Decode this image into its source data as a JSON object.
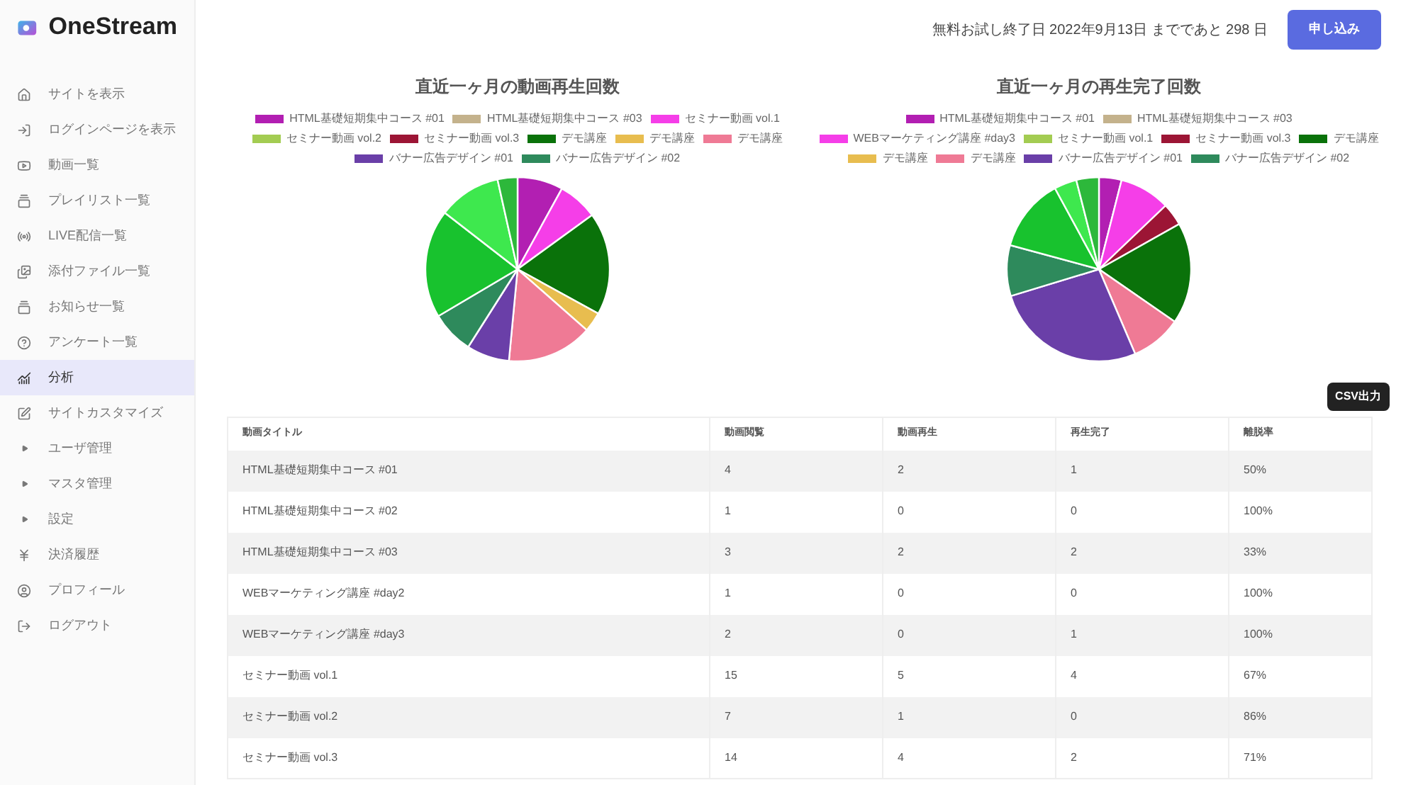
{
  "brand": {
    "name": "OneStream"
  },
  "sidebar": {
    "items": [
      {
        "label": "サイトを表示",
        "selected": false
      },
      {
        "label": "ログインページを表示",
        "selected": false
      },
      {
        "label": "動画一覧",
        "selected": false
      },
      {
        "label": "プレイリスト一覧",
        "selected": false
      },
      {
        "label": "LIVE配信一覧",
        "selected": false
      },
      {
        "label": "添付ファイル一覧",
        "selected": false
      },
      {
        "label": "お知らせ一覧",
        "selected": false
      },
      {
        "label": "アンケート一覧",
        "selected": false
      },
      {
        "label": "分析",
        "selected": true
      },
      {
        "label": "サイトカスタマイズ",
        "selected": false
      },
      {
        "label": "ユーザ管理",
        "selected": false
      },
      {
        "label": "マスタ管理",
        "selected": false
      },
      {
        "label": "設定",
        "selected": false
      },
      {
        "label": "決済履歴",
        "selected": false
      },
      {
        "label": "プロフィール",
        "selected": false
      },
      {
        "label": "ログアウト",
        "selected": false
      }
    ]
  },
  "header": {
    "trial_notice": "無料お試し終了日 2022年9月13日 までであと 298 日",
    "apply_button": "申し込み"
  },
  "charts": [
    {
      "title": "直近一ヶ月の動画再生回数",
      "legend": [
        {
          "label": "HTML基礎短期集中コース #01",
          "color": "#b21fb2"
        },
        {
          "label": "HTML基礎短期集中コース #03",
          "color": "#c4b28c"
        },
        {
          "label": "セミナー動画 vol.1",
          "color": "#f53ee8"
        },
        {
          "label": "セミナー動画 vol.2",
          "color": "#a3cc52"
        },
        {
          "label": "セミナー動画 vol.3",
          "color": "#9c1535"
        },
        {
          "label": "デモ講座",
          "color": "#0a720a"
        },
        {
          "label": "デモ講座",
          "color": "#e8bd4f"
        },
        {
          "label": "デモ講座",
          "color": "#ef7a95"
        },
        {
          "label": "バナー広告デザイン #01",
          "color": "#6a3fa8"
        },
        {
          "label": "バナー広告デザイン #02",
          "color": "#2e8a5c"
        }
      ]
    },
    {
      "title": "直近一ヶ月の再生完了回数",
      "legend": [
        {
          "label": "HTML基礎短期集中コース #01",
          "color": "#b21fb2"
        },
        {
          "label": "HTML基礎短期集中コース #03",
          "color": "#c4b28c"
        },
        {
          "label": "WEBマーケティング講座 #day3",
          "color": "#f53ee8"
        },
        {
          "label": "セミナー動画 vol.1",
          "color": "#a3cc52"
        },
        {
          "label": "セミナー動画 vol.3",
          "color": "#9c1535"
        },
        {
          "label": "デモ講座",
          "color": "#0a720a"
        },
        {
          "label": "デモ講座",
          "color": "#e8bd4f"
        },
        {
          "label": "デモ講座",
          "color": "#ef7a95"
        },
        {
          "label": "バナー広告デザイン #01",
          "color": "#6a3fa8"
        },
        {
          "label": "バナー広告デザイン #02",
          "color": "#2e8a5c"
        }
      ]
    }
  ],
  "csv_button": "CSV出力",
  "table": {
    "columns": [
      "動画タイトル",
      "動画閲覧",
      "動画再生",
      "再生完了",
      "離脱率"
    ],
    "rows": [
      [
        "HTML基礎短期集中コース #01",
        "4",
        "2",
        "1",
        "50%"
      ],
      [
        "HTML基礎短期集中コース #02",
        "1",
        "0",
        "0",
        "100%"
      ],
      [
        "HTML基礎短期集中コース #03",
        "3",
        "2",
        "2",
        "33%"
      ],
      [
        "WEBマーケティング講座 #day2",
        "1",
        "0",
        "0",
        "100%"
      ],
      [
        "WEBマーケティング講座 #day3",
        "2",
        "0",
        "1",
        "100%"
      ],
      [
        "セミナー動画 vol.1",
        "15",
        "5",
        "4",
        "67%"
      ],
      [
        "セミナー動画 vol.2",
        "7",
        "1",
        "0",
        "86%"
      ],
      [
        "セミナー動画 vol.3",
        "14",
        "4",
        "2",
        "71%"
      ]
    ]
  }
}
